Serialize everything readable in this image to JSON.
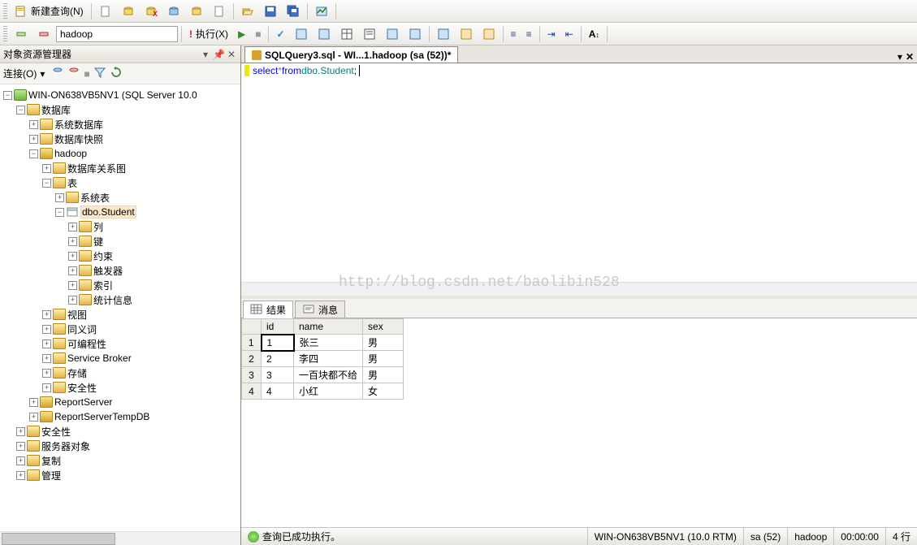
{
  "toolbar": {
    "newQuery": "新建查询(N)",
    "database": "hadoop",
    "execute": "执行(X)",
    "debugIcon": "▶"
  },
  "explorer": {
    "title": "对象资源管理器",
    "connectLabel": "连接(O)",
    "server": "WIN-ON638VB5NV1 (SQL Server 10.0",
    "nodes": {
      "databases": "数据库",
      "sysdb": "系统数据库",
      "dbsnap": "数据库快照",
      "hadoop": "hadoop",
      "dbdiag": "数据库关系图",
      "tables": "表",
      "systables": "系统表",
      "student": "dbo.Student",
      "columns": "列",
      "keys": "键",
      "constraints": "约束",
      "triggers": "触发器",
      "indexes": "索引",
      "stats": "统计信息",
      "views": "视图",
      "synonyms": "同义词",
      "programmability": "可编程性",
      "servicebroker": "Service Broker",
      "storage": "存储",
      "security_db": "安全性",
      "reportserver": "ReportServer",
      "reportservertemp": "ReportServerTempDB",
      "security": "安全性",
      "serverobjects": "服务器对象",
      "replication": "复制",
      "management": "管理"
    }
  },
  "tab": {
    "title": "SQLQuery3.sql - WI...1.hadoop (sa (52))*"
  },
  "sql": {
    "select": "select",
    "star": " * ",
    "from": "from",
    "space": " ",
    "ident": "dbo.Student",
    "semi": ";"
  },
  "watermark": "http://blog.csdn.net/baolibin528",
  "results": {
    "tabResult": "结果",
    "tabMessage": "消息",
    "columns": [
      "id",
      "name",
      "sex"
    ],
    "rows": [
      {
        "n": "1",
        "id": "1",
        "name": "张三",
        "sex": "男"
      },
      {
        "n": "2",
        "id": "2",
        "name": "李四",
        "sex": "男"
      },
      {
        "n": "3",
        "id": "3",
        "name": "一百块都不给",
        "sex": "男"
      },
      {
        "n": "4",
        "id": "4",
        "name": "小红",
        "sex": "女"
      }
    ]
  },
  "status": {
    "message": "查询已成功执行。",
    "server": "WIN-ON638VB5NV1 (10.0 RTM)",
    "user": "sa (52)",
    "db": "hadoop",
    "time": "00:00:00",
    "rows": "4 行"
  }
}
